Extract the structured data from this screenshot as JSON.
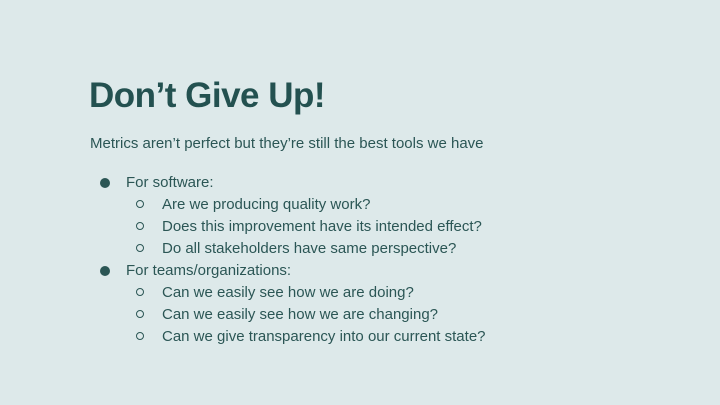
{
  "slide": {
    "title": "Don’t Give Up!",
    "subtitle": "Metrics aren’t perfect but they’re still the best tools we have",
    "sections": [
      {
        "label": "For software:",
        "items": [
          "Are we producing quality work?",
          "Does this improvement have its intended effect?",
          "Do all stakeholders have same perspective?"
        ]
      },
      {
        "label": "For teams/organizations:",
        "items": [
          "Can we easily see how we are doing?",
          "Can we easily see how we are changing?",
          "Can we give transparency into our current state?"
        ]
      }
    ],
    "colors": {
      "background": "#dde9ea",
      "text": "#245150"
    }
  }
}
